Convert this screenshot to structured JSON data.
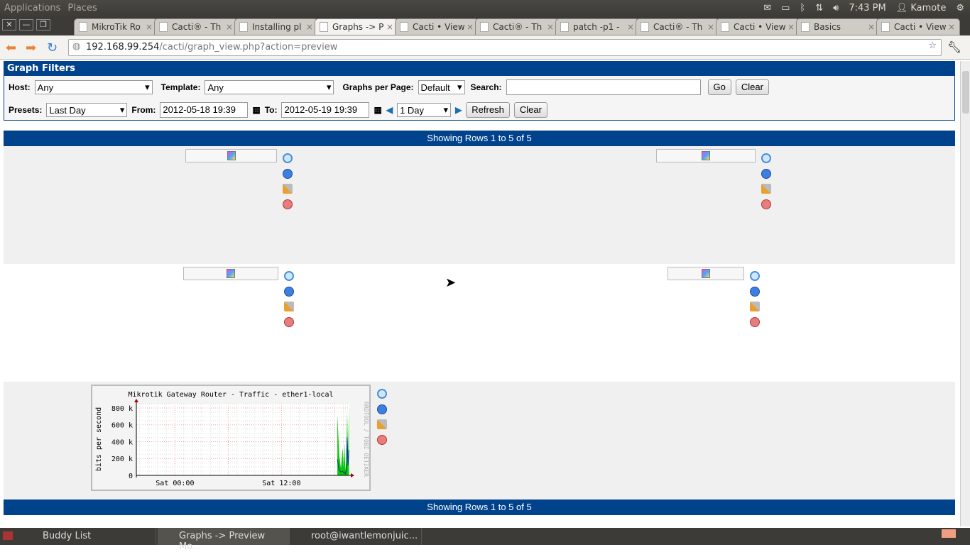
{
  "topbar": {
    "menus": [
      "Applications",
      "Places"
    ],
    "clock": "7:43 PM",
    "user": "Kamote"
  },
  "browser": {
    "tabs": [
      {
        "label": "MikroTik Ro"
      },
      {
        "label": "Cacti® - Th"
      },
      {
        "label": "Installing pl"
      },
      {
        "label": "Graphs -> P",
        "active": true
      },
      {
        "label": "Cacti • View"
      },
      {
        "label": "Cacti® - Th"
      },
      {
        "label": "patch -p1 -"
      },
      {
        "label": "Cacti® - Th"
      },
      {
        "label": "Cacti • View"
      },
      {
        "label": "Basics"
      },
      {
        "label": "Cacti • View"
      }
    ],
    "url_host": "192.168.99.254",
    "url_path": "/cacti/graph_view.php?action=preview"
  },
  "filters": {
    "title": "Graph Filters",
    "host_label": "Host:",
    "host_value": "Any",
    "template_label": "Template:",
    "template_value": "Any",
    "gpp_label": "Graphs per Page:",
    "gpp_value": "Default",
    "search_label": "Search:",
    "search_value": "",
    "go": "Go",
    "clear": "Clear",
    "presets_label": "Presets:",
    "presets_value": "Last Day",
    "from_label": "From:",
    "from_value": "2012-05-18 19:39",
    "to_label": "To:",
    "to_value": "2012-05-19 19:39",
    "span_value": "1 Day",
    "refresh": "Refresh",
    "clear2": "Clear"
  },
  "rows_text": "Showing Rows 1 to 5 of 5",
  "chart_data": {
    "type": "area",
    "title": "Mikrotik Gateway Router - Traffic - ether1-local",
    "ylabel": "bits per second",
    "watermark": "RRDTOOL / TOBI OETIKER",
    "yticks": [
      "0",
      "200 k",
      "400 k",
      "600 k",
      "800 k"
    ],
    "ylim": [
      0,
      850000
    ],
    "xticks": [
      "Sat 00:00",
      "Sat 12:00"
    ],
    "xrange_hours": [
      -4.35,
      19.65
    ],
    "grid": true,
    "x_hours": [
      18.3,
      18.5,
      18.7,
      18.9,
      19.0,
      19.1,
      19.2,
      19.3,
      19.4,
      19.5,
      19.6
    ],
    "series": [
      {
        "color": "#00cc00",
        "values": [
          720000,
          250000,
          80000,
          330000,
          90000,
          380000,
          60000,
          150000,
          750000,
          200000,
          800000
        ]
      },
      {
        "color": "#002a97",
        "values": [
          190000,
          60000,
          40000,
          50000,
          30000,
          40000,
          20000,
          60000,
          450000,
          120000,
          300000
        ]
      }
    ]
  },
  "taskbar": {
    "items": [
      "Buddy List",
      "Graphs -> Preview Mo...",
      "root@iwantlemonjuic..."
    ]
  }
}
